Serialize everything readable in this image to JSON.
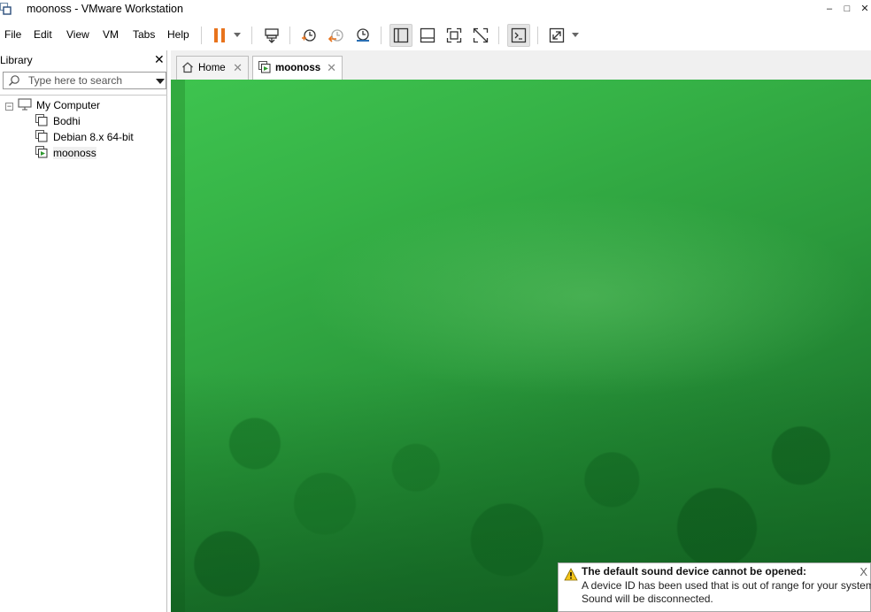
{
  "window": {
    "title": "moonoss - VMware Workstation",
    "app_icon": "vmware-icon",
    "controls": {
      "minimize": "–",
      "maximize": "□",
      "close": "✕"
    }
  },
  "menu": {
    "items": [
      "File",
      "Edit",
      "View",
      "VM",
      "Tabs",
      "Help"
    ]
  },
  "toolbar": {
    "buttons": [
      "pause-icon",
      "send-ctrl-alt-del-icon",
      "snapshot-take-icon",
      "snapshot-revert-icon",
      "snapshot-manager-icon",
      "show-library-icon",
      "thumbnail-bar-icon",
      "full-screen-icon",
      "unity-icon",
      "console-view-icon",
      "stretch-guest-icon"
    ],
    "pause_color": "#e8731c"
  },
  "library": {
    "title": "Library",
    "close": "✕",
    "search_placeholder": "Type here to search",
    "tree": {
      "root": "My Computer",
      "expander": "−",
      "vms": [
        "Bodhi",
        "Debian 8.x 64-bit",
        "moonoss"
      ],
      "selected": "moonoss"
    }
  },
  "tabs": [
    {
      "label": "Home",
      "icon": "home-icon",
      "close": "✕",
      "active": false
    },
    {
      "label": "moonoss",
      "icon": "vm-running-icon",
      "close": "✕",
      "active": true
    }
  ],
  "vm_screen": {
    "accent": "#2b9a3c"
  },
  "notification": {
    "icon": "warning-icon",
    "title": "The default sound device cannot be opened:",
    "line1": "A device ID has been used that is out of range for your system.",
    "line2": "Sound will be disconnected.",
    "close": "X"
  }
}
